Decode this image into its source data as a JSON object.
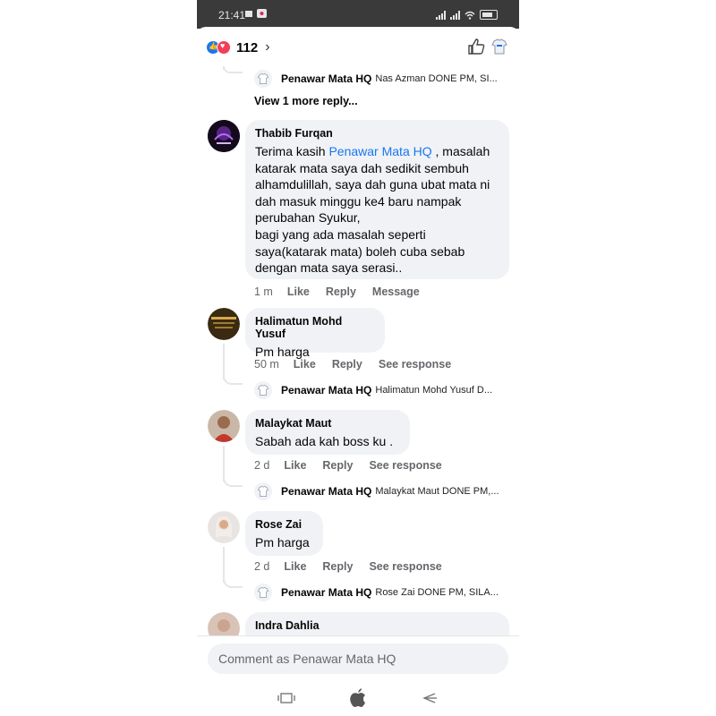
{
  "status_bar": {
    "time": "21:41",
    "battery": "85"
  },
  "header": {
    "reaction_count": "112"
  },
  "thread_top": {
    "reply": {
      "name": "Penawar Mata HQ",
      "text": "Nas Azman DONE PM, SI..."
    },
    "view_more": "View 1 more reply..."
  },
  "comments": [
    {
      "name": "Thabib Furqan",
      "text_before": "Terima kasih ",
      "mention": "Penawar Mata HQ",
      "text_after": " , masalah katarak mata saya dah sedikit sembuh alhamdulillah, saya dah guna ubat mata ni dah masuk minggu ke4 baru nampak perubahan Syukur,\nbagi yang ada masalah seperti saya(katarak mata) boleh cuba sebab dengan mata saya serasi..",
      "time": "1 m",
      "like": "Like",
      "reply": "Reply",
      "extra": "Message"
    },
    {
      "name": "Halimatun Mohd Yusuf",
      "text": "Pm harga",
      "time": "50 m",
      "like": "Like",
      "reply": "Reply",
      "extra": "See response",
      "page_reply": {
        "name": "Penawar Mata HQ",
        "text": "Halimatun Mohd Yusuf D..."
      }
    },
    {
      "name": "Malaykat Maut",
      "text": "Sabah ada kah boss ku .",
      "time": "2 d",
      "like": "Like",
      "reply": "Reply",
      "extra": "See response",
      "page_reply": {
        "name": "Penawar Mata HQ",
        "text": "Malaykat Maut DONE PM,..."
      }
    },
    {
      "name": "Rose Zai",
      "text": "Pm harga",
      "time": "2 d",
      "like": "Like",
      "reply": "Reply",
      "extra": "See response",
      "page_reply": {
        "name": "Penawar Mata HQ",
        "text": "Rose Zai DONE PM, SILA..."
      }
    },
    {
      "name": "Indra Dahlia"
    }
  ],
  "composer": {
    "placeholder": "Comment as Penawar Mata HQ"
  },
  "colors": {
    "accent": "#1877f2",
    "bubble": "#f0f2f5",
    "meta": "#65676b",
    "statusbar": "#3a3a3a"
  },
  "icons": [
    "like-reaction-icon",
    "love-reaction-icon",
    "chevron-right-icon",
    "thumbs-up-icon",
    "page-logo-icon",
    "recents-icon",
    "home-icon",
    "back-icon"
  ]
}
